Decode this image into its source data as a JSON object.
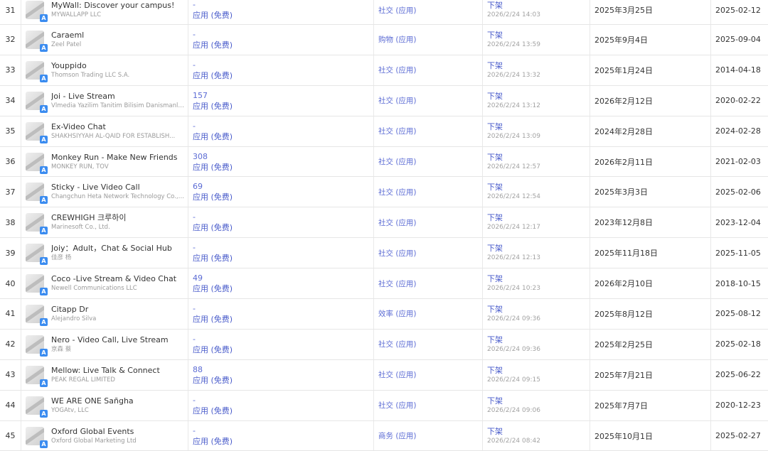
{
  "store_badge": "A",
  "colors": {
    "link": "#4a5ccb",
    "muted": "#9a9a9a",
    "store_badge": "#3b8cf0"
  },
  "rows": [
    {
      "idx": "31",
      "name": "MyWall: Discover your campus!",
      "dev": "MYWALLAPP LLC",
      "rank": "-",
      "type": "应用 (免费)",
      "cat": "社交 (应用)",
      "status": "下架",
      "status_time": "2026/2/24 14:03",
      "date1": "2025年3月25日",
      "date2": "2025-02-12"
    },
    {
      "idx": "32",
      "name": "Caraeml",
      "dev": "Zeel Patel",
      "rank": "-",
      "type": "应用 (免费)",
      "cat": "购物 (应用)",
      "status": "下架",
      "status_time": "2026/2/24 13:59",
      "date1": "2025年9月4日",
      "date2": "2025-09-04"
    },
    {
      "idx": "33",
      "name": "Youppido",
      "dev": "Thomson Trading LLC S.A.",
      "rank": "-",
      "type": "应用 (免费)",
      "cat": "社交 (应用)",
      "status": "下架",
      "status_time": "2026/2/24 13:32",
      "date1": "2025年1月24日",
      "date2": "2014-04-18"
    },
    {
      "idx": "34",
      "name": "Joi - Live Stream",
      "dev": "Vlmedia Yazilim Tanitim Bilisim Danismanlik...",
      "rank": "157",
      "type": "应用 (免费)",
      "cat": "社交 (应用)",
      "status": "下架",
      "status_time": "2026/2/24 13:12",
      "date1": "2026年2月12日",
      "date2": "2020-02-22"
    },
    {
      "idx": "35",
      "name": "Ex-Video Chat",
      "dev": "SHAKHSIYYAH AL-QAID FOR ESTABLISH...",
      "rank": "-",
      "type": "应用 (免费)",
      "cat": "社交 (应用)",
      "status": "下架",
      "status_time": "2026/2/24 13:09",
      "date1": "2024年2月28日",
      "date2": "2024-02-28"
    },
    {
      "idx": "36",
      "name": "Monkey Run - Make New Friends",
      "dev": "MONKEY RUN, TOV",
      "rank": "308",
      "type": "应用 (免费)",
      "cat": "社交 (应用)",
      "status": "下架",
      "status_time": "2026/2/24 12:57",
      "date1": "2026年2月11日",
      "date2": "2021-02-03"
    },
    {
      "idx": "37",
      "name": "Sticky - Live Video Call",
      "dev": "Changchun Heta Network Technology Co., L...",
      "rank": "69",
      "type": "应用 (免费)",
      "cat": "社交 (应用)",
      "status": "下架",
      "status_time": "2026/2/24 12:54",
      "date1": "2025年3月3日",
      "date2": "2025-02-06"
    },
    {
      "idx": "38",
      "name": "CREWHIGH 크루하이",
      "dev": "Marinesoft Co., Ltd.",
      "rank": "-",
      "type": "应用 (免费)",
      "cat": "社交 (应用)",
      "status": "下架",
      "status_time": "2026/2/24 12:17",
      "date1": "2023年12月8日",
      "date2": "2023-12-04"
    },
    {
      "idx": "39",
      "name": "Joiy：Adult，Chat & Social Hub",
      "dev": "佳彦 杨",
      "rank": "-",
      "type": "应用 (免费)",
      "cat": "社交 (应用)",
      "status": "下架",
      "status_time": "2026/2/24 12:13",
      "date1": "2025年11月18日",
      "date2": "2025-11-05"
    },
    {
      "idx": "40",
      "name": "Coco -Live Stream & Video Chat",
      "dev": "Newell Communications LLC",
      "rank": "49",
      "type": "应用 (免费)",
      "cat": "社交 (应用)",
      "status": "下架",
      "status_time": "2026/2/24 10:23",
      "date1": "2026年2月10日",
      "date2": "2018-10-15"
    },
    {
      "idx": "41",
      "name": "Citapp Dr",
      "dev": "Alejandro Silva",
      "rank": "-",
      "type": "应用 (免费)",
      "cat": "效率 (应用)",
      "status": "下架",
      "status_time": "2026/2/24 09:36",
      "date1": "2025年8月12日",
      "date2": "2025-08-12"
    },
    {
      "idx": "42",
      "name": "Nero - Video Call, Live Stream",
      "dev": "京森 蔡",
      "rank": "-",
      "type": "应用 (免费)",
      "cat": "社交 (应用)",
      "status": "下架",
      "status_time": "2026/2/24 09:36",
      "date1": "2025年2月25日",
      "date2": "2025-02-18"
    },
    {
      "idx": "43",
      "name": "Mellow: Live Talk & Connect",
      "dev": "PEAK REGAL LIMITED",
      "rank": "88",
      "type": "应用 (免费)",
      "cat": "社交 (应用)",
      "status": "下架",
      "status_time": "2026/2/24 09:15",
      "date1": "2025年7月21日",
      "date2": "2025-06-22"
    },
    {
      "idx": "44",
      "name": "WE ARE ONE Sañgha",
      "dev": "YOGAtv, LLC",
      "rank": "-",
      "type": "应用 (免费)",
      "cat": "社交 (应用)",
      "status": "下架",
      "status_time": "2026/2/24 09:06",
      "date1": "2025年7月7日",
      "date2": "2020-12-23"
    },
    {
      "idx": "45",
      "name": "Oxford Global Events",
      "dev": "Oxford Global Marketing Ltd",
      "rank": "-",
      "type": "应用 (免费)",
      "cat": "商务 (应用)",
      "status": "下架",
      "status_time": "2026/2/24 08:42",
      "date1": "2025年10月1日",
      "date2": "2025-02-27"
    }
  ]
}
